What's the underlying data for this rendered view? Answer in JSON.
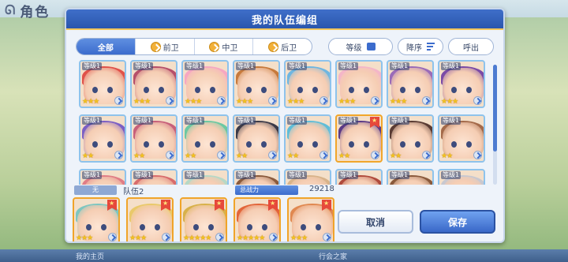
{
  "background": {
    "title": "角色",
    "nav": [
      "我的主页",
      "",
      "",
      "行会之家",
      "",
      "",
      ""
    ]
  },
  "dialog": {
    "title": "我的队伍编组",
    "filters": [
      {
        "label": "全部",
        "active": true
      },
      {
        "label": "前卫",
        "active": false
      },
      {
        "label": "中卫",
        "active": false
      },
      {
        "label": "后卫",
        "active": false
      }
    ],
    "sort_level_label": "等级",
    "sort_order_label": "降序",
    "fav_label": "呼出"
  },
  "roster": {
    "level_text": "等级1",
    "cards": [
      {
        "hair": "#e0524a",
        "stars": "★★★",
        "row": 0,
        "col": 0
      },
      {
        "hair": "#b64f6a",
        "stars": "★★★",
        "row": 0,
        "col": 1
      },
      {
        "hair": "#f6a7c2",
        "stars": "★★★",
        "row": 0,
        "col": 2
      },
      {
        "hair": "#c77a3c",
        "stars": "★★★",
        "row": 0,
        "col": 3
      },
      {
        "hair": "#6fb6e0",
        "stars": "★★★",
        "row": 0,
        "col": 4
      },
      {
        "hair": "#f4b6c8",
        "stars": "★★★",
        "row": 0,
        "col": 5
      },
      {
        "hair": "#9a6bb8",
        "stars": "★★★",
        "row": 0,
        "col": 6
      },
      {
        "hair": "#7b4ba6",
        "stars": "★★★",
        "row": 0,
        "col": 7
      },
      {
        "hair": "#7b5fc4",
        "stars": "★★",
        "row": 1,
        "col": 0
      },
      {
        "hair": "#c7607a",
        "stars": "★★",
        "row": 1,
        "col": 1
      },
      {
        "hair": "#6cc8a2",
        "stars": "★★",
        "row": 1,
        "col": 2
      },
      {
        "hair": "#3b3a48",
        "stars": "★★",
        "row": 1,
        "col": 3
      },
      {
        "hair": "#5fbdd8",
        "stars": "★★",
        "row": 1,
        "col": 4
      },
      {
        "hair": "#5b3a86",
        "stars": "★★",
        "row": 1,
        "col": 5,
        "selected": true
      },
      {
        "hair": "#5a3b33",
        "stars": "★★",
        "row": 1,
        "col": 6
      },
      {
        "hair": "#a46a4a",
        "stars": "★★",
        "row": 1,
        "col": 7
      },
      {
        "hair": "#e07d86",
        "stars": "",
        "row": 2,
        "col": 0
      },
      {
        "hair": "#d86c6c",
        "stars": "",
        "row": 2,
        "col": 1
      },
      {
        "hair": "#b6d8c6",
        "stars": "",
        "row": 2,
        "col": 2
      },
      {
        "hair": "#8a5a3c",
        "stars": "",
        "row": 2,
        "col": 3
      },
      {
        "hair": "#d8b38a",
        "stars": "",
        "row": 2,
        "col": 4
      },
      {
        "hair": "#b04a3c",
        "stars": "",
        "row": 2,
        "col": 5
      },
      {
        "hair": "#8a5a3c",
        "stars": "",
        "row": 2,
        "col": 6
      },
      {
        "hair": "#c8c8d0",
        "stars": "",
        "row": 2,
        "col": 7
      }
    ]
  },
  "team": {
    "tag": "无",
    "name": "队伍2",
    "power_label": "总战力",
    "power_value": "29218",
    "slots": [
      {
        "hair": "#7fc6c0",
        "stars": "★★★"
      },
      {
        "hair": "#e9c96a",
        "stars": "★★★"
      },
      {
        "hair": "#d8b14a",
        "stars": "★★★★★"
      },
      {
        "hair": "#e2663a",
        "stars": "★★★★★"
      },
      {
        "hair": "#e08850",
        "stars": "★★★"
      }
    ]
  },
  "buttons": {
    "cancel": "取消",
    "save": "保存"
  },
  "colors": {
    "header": "#2a56ad",
    "accent_gold": "#f1c55a",
    "save_button": "#3a68c8"
  }
}
